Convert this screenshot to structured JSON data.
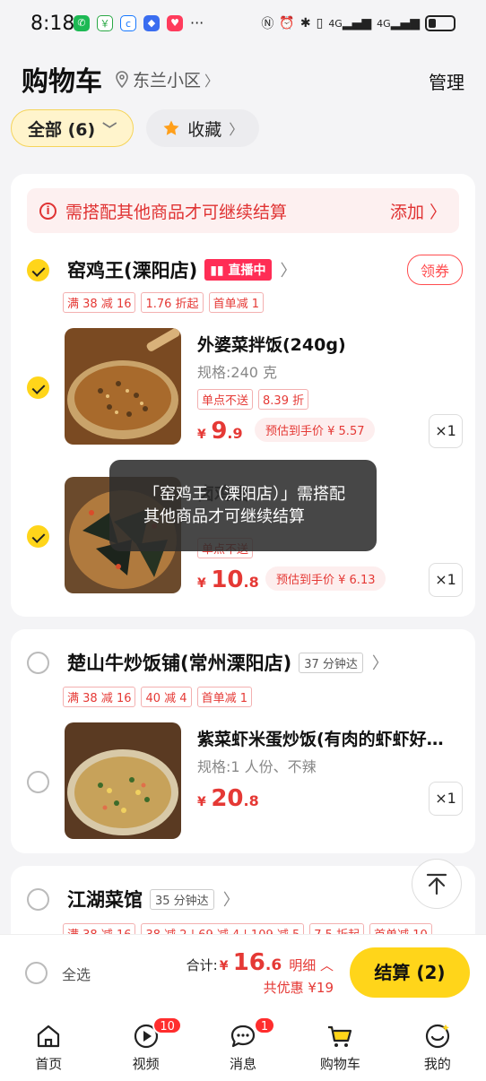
{
  "status_bar": {
    "time": "8:18",
    "more": "···",
    "network": "4G"
  },
  "header": {
    "title": "购物车",
    "location": "东兰小区",
    "manage": "管理"
  },
  "filters": [
    {
      "label": "全部 (6)"
    },
    {
      "label": "收藏"
    }
  ],
  "notice": {
    "text": "需搭配其他商品才可继续结算",
    "action": "添加"
  },
  "stores": [
    {
      "name": "窑鸡王(溧阳店)",
      "live_badge": "直播中",
      "coupon": "领券",
      "promos": [
        "满 38 减 16",
        "1.76 折起",
        "首单减 1"
      ],
      "items": [
        {
          "name": "外婆菜拌饭(240g)",
          "spec": "规格:240 克",
          "tags": [
            "单点不送",
            "8.39 折"
          ],
          "price_int": "9",
          "price_dec": ".9",
          "estimate": "预估到手价 ¥ 5.57",
          "qty": "×1"
        },
        {
          "name": "卤鸡蛋",
          "spec": "",
          "tags": [
            "单点不送"
          ],
          "price_int": "10",
          "price_dec": ".8",
          "estimate": "预估到手价 ¥ 6.13",
          "qty": "×1"
        }
      ]
    },
    {
      "name": "楚山牛炒饭铺(常州溧阳店)",
      "eta": "37 分钟达",
      "promos": [
        "满 38 减 16",
        "40 减 4",
        "首单减 1"
      ],
      "items": [
        {
          "name": "紫菜虾米蛋炒饭(有肉的虾虾好…",
          "spec": "规格:1 人份、不辣",
          "price_int": "20",
          "price_dec": ".8",
          "qty": "×1"
        }
      ]
    },
    {
      "name": "江湖菜馆",
      "eta": "35 分钟达",
      "promos": [
        "满 38 减 16",
        "38 减 2 | 69 减 4 | 109 减 5",
        "7.5 折起",
        "首单减 10"
      ]
    }
  ],
  "toast": "「窑鸡王（溧阳店）」需搭配其他商品才可继续结算",
  "summary": {
    "select_all": "全选",
    "total_label": "合计:",
    "total_int": "16",
    "total_dec": ".6",
    "detail": "明细",
    "discount": "共优惠 ¥19",
    "checkout": "结算 (2)"
  },
  "tabs": [
    {
      "label": "首页"
    },
    {
      "label": "视频",
      "badge": "10"
    },
    {
      "label": "消息",
      "badge": "1"
    },
    {
      "label": "购物车"
    },
    {
      "label": "我的"
    }
  ],
  "colors": {
    "accent": "#ffd51a",
    "price": "#e53935",
    "live": "#ff2d55",
    "badge": "#ff2d2d"
  }
}
